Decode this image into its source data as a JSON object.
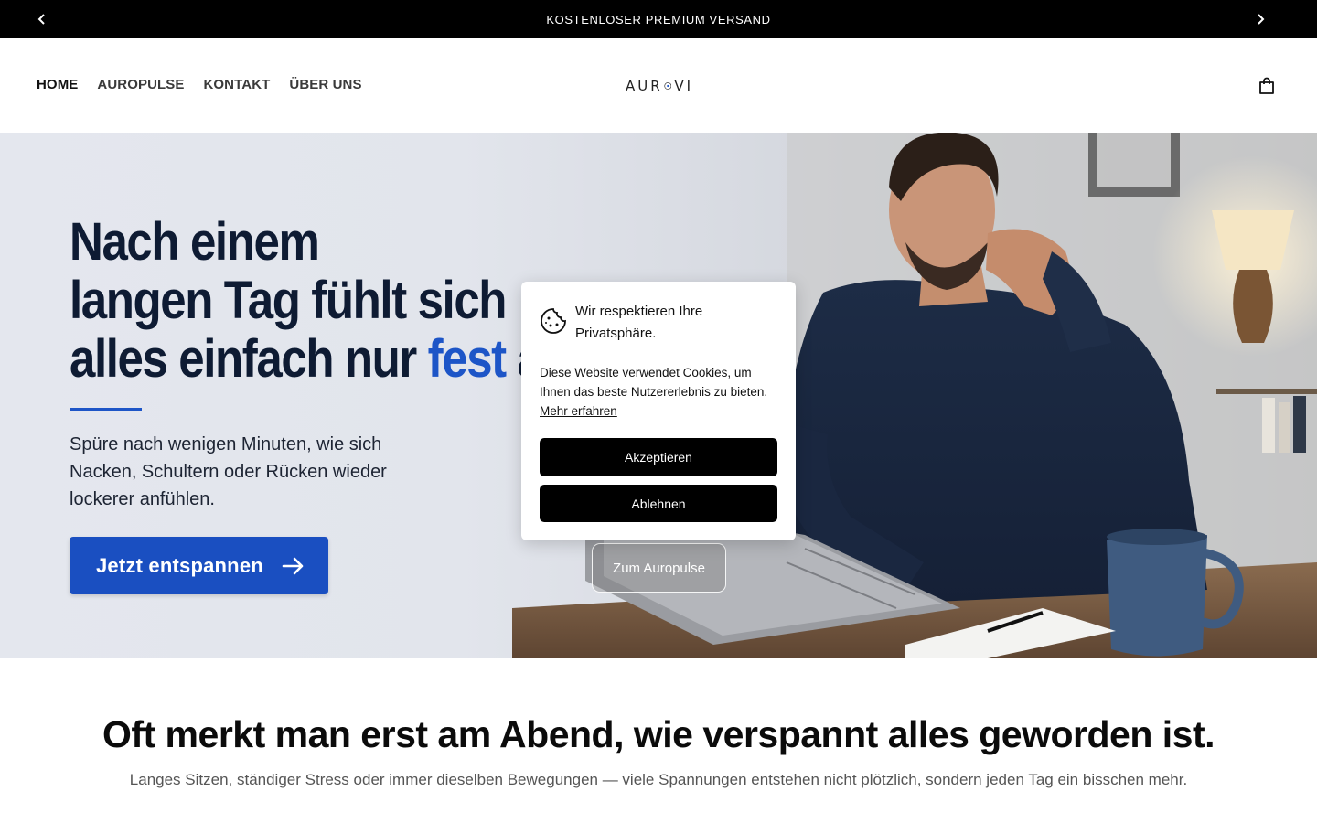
{
  "announcement": {
    "text": "KOSTENLOSER PREMIUM VERSAND",
    "prev_icon": "chevron-left-icon",
    "next_icon": "chevron-right-icon"
  },
  "header": {
    "nav": [
      {
        "label": "HOME",
        "active": true
      },
      {
        "label": "AUROPULSE",
        "active": false
      },
      {
        "label": "KONTAKT",
        "active": false
      },
      {
        "label": "ÜBER UNS",
        "active": false
      }
    ],
    "logo_text_left": "AUR",
    "logo_text_right": "VI",
    "cart_icon": "shopping-bag-icon"
  },
  "hero": {
    "title_line1": "Nach einem",
    "title_line2": "langen Tag fühlt sich",
    "title_line3_pre": "alles einfach nur ",
    "title_line3_highlight": "fest",
    "title_line3_post": " an",
    "subtitle": "Spüre nach wenigen Minuten, wie sich Nacken, Schultern oder Rücken wieder lockerer anfühlen.",
    "cta_label": "Jetzt entspannen",
    "cta_icon": "arrow-right-icon",
    "secondary_label": "Zum Auropulse",
    "accent_color": "#1a4fc1",
    "title_color": "#0e1b33"
  },
  "cookie": {
    "icon": "cookie-icon",
    "title": "Wir respektieren Ihre Privatsphäre.",
    "text": "Diese Website verwendet Cookies, um Ihnen das beste Nutzererlebnis zu bieten.",
    "link": "Mehr erfahren",
    "accept": "Akzeptieren",
    "decline": "Ablehnen"
  },
  "section": {
    "title": "Oft merkt man erst am Abend, wie verspannt alles geworden ist.",
    "subtitle": "Langes Sitzen, ständiger Stress oder immer dieselben Bewegungen — viele Spannungen entstehen nicht plötzlich, sondern jeden Tag ein bisschen mehr."
  }
}
